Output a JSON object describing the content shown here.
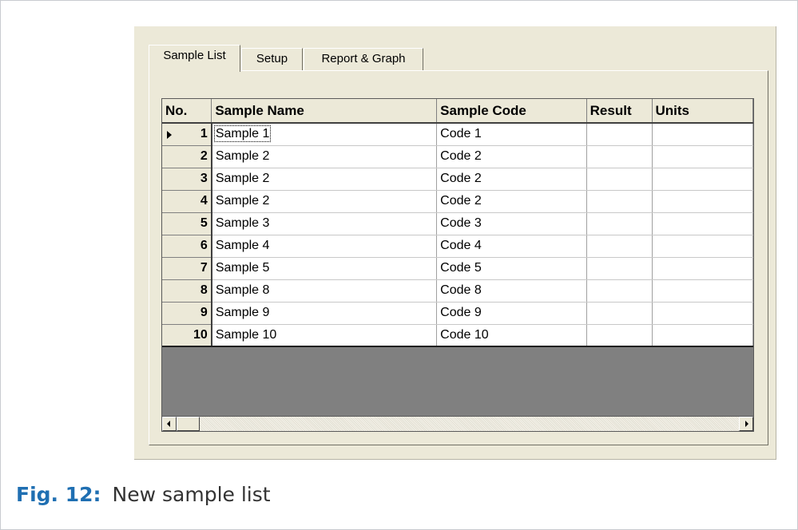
{
  "tabs": [
    {
      "label": "Sample List"
    },
    {
      "label": "Setup"
    },
    {
      "label": "Report & Graph"
    }
  ],
  "grid": {
    "columns": [
      "No.",
      "Sample Name",
      "Sample Code",
      "Result",
      "Units"
    ],
    "rows": [
      {
        "no": "1",
        "name": "Sample 1",
        "code": "Code 1",
        "result": "",
        "units": ""
      },
      {
        "no": "2",
        "name": "Sample 2",
        "code": "Code 2",
        "result": "",
        "units": ""
      },
      {
        "no": "3",
        "name": "Sample 2",
        "code": "Code 2",
        "result": "",
        "units": ""
      },
      {
        "no": "4",
        "name": "Sample 2",
        "code": "Code 2",
        "result": "",
        "units": ""
      },
      {
        "no": "5",
        "name": "Sample 3",
        "code": "Code 3",
        "result": "",
        "units": ""
      },
      {
        "no": "6",
        "name": "Sample 4",
        "code": "Code 4",
        "result": "",
        "units": ""
      },
      {
        "no": "7",
        "name": "Sample 5",
        "code": "Code 5",
        "result": "",
        "units": ""
      },
      {
        "no": "8",
        "name": "Sample 8",
        "code": "Code 8",
        "result": "",
        "units": ""
      },
      {
        "no": "9",
        "name": "Sample 9",
        "code": "Code 9",
        "result": "",
        "units": ""
      },
      {
        "no": "10",
        "name": "Sample 10",
        "code": "Code 10",
        "result": "",
        "units": ""
      }
    ]
  },
  "icons": {
    "current_row": "row-pointer-icon",
    "scroll_left": "arrow-left-icon",
    "scroll_right": "arrow-right-icon"
  },
  "caption": {
    "label": "Fig. 12:",
    "text": "New sample list"
  }
}
